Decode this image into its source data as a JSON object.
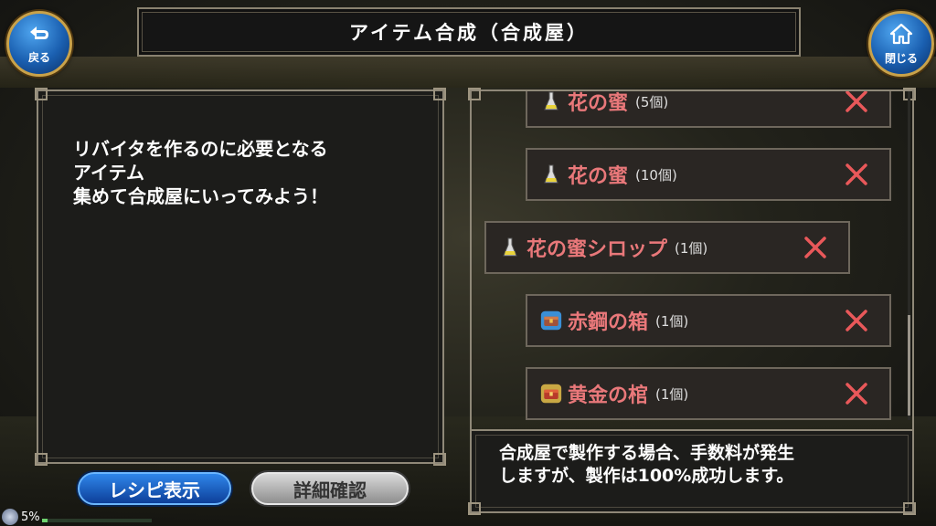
{
  "title": "アイテム合成（合成屋）",
  "back_button": {
    "label": "戻る",
    "icon": "back-arrow-icon"
  },
  "close_button": {
    "label": "閉じる",
    "icon": "home-icon"
  },
  "left_panel": {
    "lines": [
      "リバイタを作るのに必要となる",
      "アイテム",
      "集めて合成屋にいってみよう！"
    ]
  },
  "items": [
    {
      "name": "花の蜜",
      "qty": "(5個)",
      "icon": "potion-flask-icon"
    },
    {
      "name": "花の蜜",
      "qty": "(10個)",
      "icon": "potion-flask-icon"
    },
    {
      "name": "花の蜜シロップ",
      "qty": "(1個)",
      "icon": "potion-flask-icon"
    },
    {
      "name": "赤鋼の箱",
      "qty": "(1個)",
      "icon": "treasure-chest-blue-icon"
    },
    {
      "name": "黄金の棺",
      "qty": "(1個)",
      "icon": "treasure-chest-gold-icon"
    }
  ],
  "info_panel": {
    "lines": [
      "合成屋で製作する場合、手数料が発生",
      "しますが、製作は100%成功します。"
    ]
  },
  "buttons": {
    "recipe": "レシピ表示",
    "detail": "詳細確認"
  },
  "status": {
    "percent_text": "5%",
    "progress": 0.05
  },
  "colors": {
    "item_name": "#e9787a",
    "remove_x": "#e9585a",
    "recipe_button": "#1f63c8",
    "detail_button": "#b5b5b5"
  }
}
